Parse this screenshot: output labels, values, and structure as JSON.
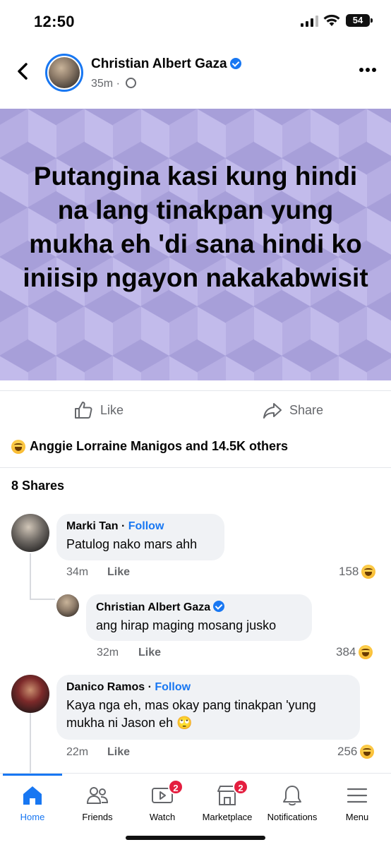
{
  "status_bar": {
    "time": "12:50",
    "battery": "54"
  },
  "post": {
    "author": "Christian Albert Gaza",
    "time": "35m",
    "meta_separator": "·",
    "text": "Putangina kasi kung hindi na lang tinakpan yung mukha eh 'di sana hindi ko iniisip ngayon nakakabwisit",
    "background_color": "#b6aee3"
  },
  "actions": {
    "like": "Like",
    "share": "Share"
  },
  "reactions": {
    "summary": "Anggie Lorraine Manigos and 14.5K others"
  },
  "shares": "8 Shares",
  "comments": [
    {
      "name": "Marki Tan",
      "follow": "Follow",
      "separator": "·",
      "text": "Patulog nako mars ahh",
      "time": "34m",
      "like": "Like",
      "count": "158"
    },
    {
      "name": "Christian Albert Gaza",
      "text": "ang hirap maging mosang jusko",
      "time": "32m",
      "like": "Like",
      "count": "384"
    },
    {
      "name": "Danico Ramos",
      "follow": "Follow",
      "separator": "·",
      "text": "Kaya nga eh, mas okay pang tinakpan 'yung mukha ni Jason eh 🙄",
      "time": "22m",
      "like": "Like",
      "count": "256"
    }
  ],
  "bottom_nav": [
    {
      "label": "Home",
      "icon": "home-icon",
      "active": true
    },
    {
      "label": "Friends",
      "icon": "friends-icon"
    },
    {
      "label": "Watch",
      "icon": "watch-icon",
      "badge": "2"
    },
    {
      "label": "Marketplace",
      "icon": "marketplace-icon",
      "badge": "2"
    },
    {
      "label": "Notifications",
      "icon": "bell-icon"
    },
    {
      "label": "Menu",
      "icon": "menu-icon"
    }
  ],
  "colors": {
    "accent": "#1877f2",
    "badge": "#e41e3f",
    "muted": "#65676b"
  }
}
